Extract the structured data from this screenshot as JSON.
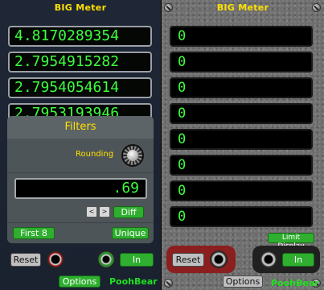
{
  "left_module": {
    "title": "BIG Meter",
    "readouts": [
      "4.8170289354",
      "2.7954915282",
      "2.7954054614",
      "2.7953193946"
    ],
    "filters": {
      "title": "Filters",
      "rounding_label": "Rounding",
      "rounding_value": ".69",
      "prev_label": "<",
      "next_label": ">",
      "diff_label": "Diff",
      "first8_label": "First 8",
      "unique_label": "Unique"
    },
    "reset_label": "Reset",
    "in_label": "In",
    "options_label": "Options",
    "brand": "PoohBear"
  },
  "right_module": {
    "title": "BIG Meter",
    "readouts": [
      "0",
      "0",
      "0",
      "0",
      "0",
      "0",
      "0",
      "0"
    ],
    "limit_display_label": "Limit Display",
    "reset_label": "Reset",
    "in_label": "In",
    "options_label": "Options",
    "brand": "PoohBear"
  },
  "colors": {
    "title": "#ffe100",
    "digits": "#3dff3d",
    "button_green": "#2fae2f",
    "reset_red_bg": "#8b1e1e"
  }
}
